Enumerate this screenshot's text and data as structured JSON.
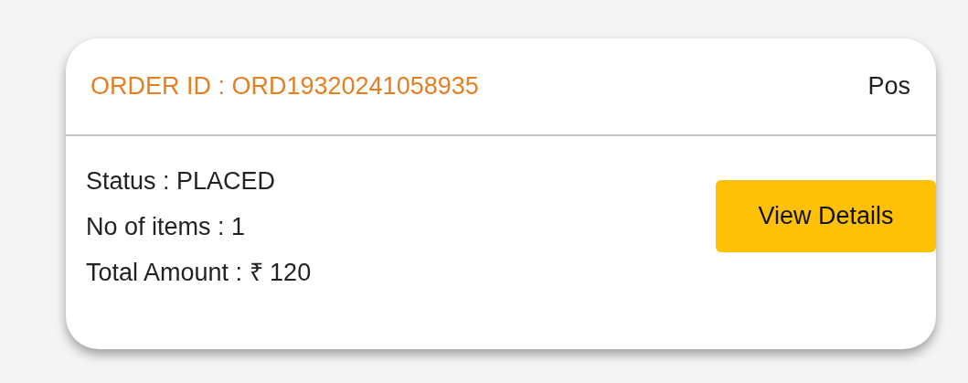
{
  "order_card": {
    "order_id": "ORDER ID : ORD19320241058935",
    "header_right": "Pos",
    "details": [
      "Status : PLACED",
      "No of items : 1",
      "Total Amount : ₹ 120"
    ],
    "button": "View Details"
  }
}
